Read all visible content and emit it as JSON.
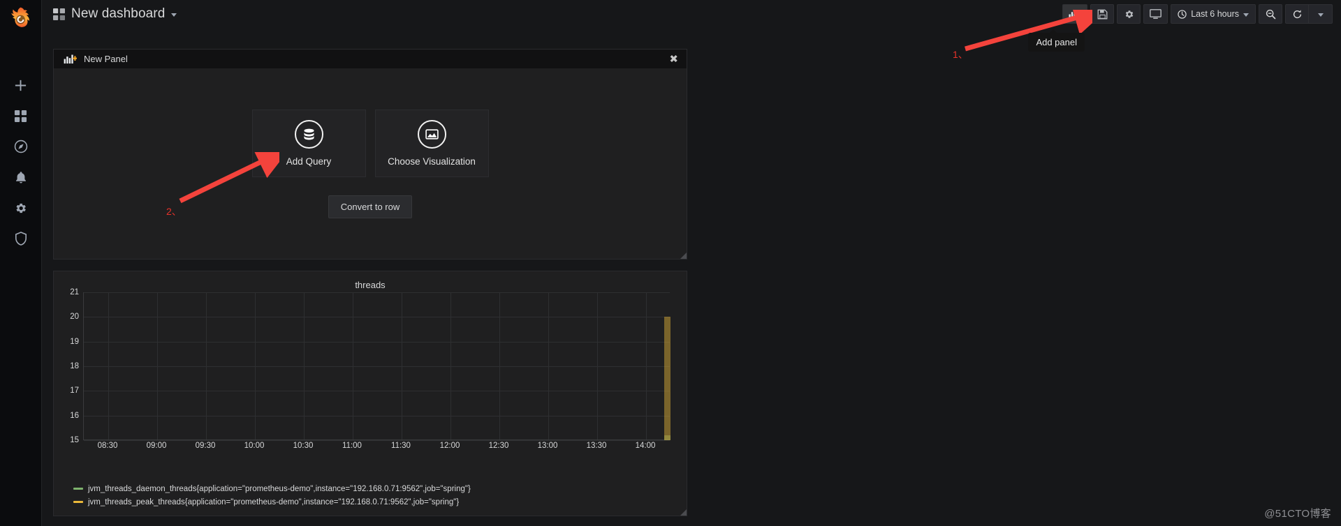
{
  "app": {
    "logo": "grafana-logo",
    "background": "#161719"
  },
  "sidebar": {
    "items": [
      {
        "name": "create-add",
        "icon": "plus-icon"
      },
      {
        "name": "dashboards",
        "icon": "dashboards-grid-icon"
      },
      {
        "name": "explore",
        "icon": "compass-icon"
      },
      {
        "name": "alerting",
        "icon": "bell-icon"
      },
      {
        "name": "configuration",
        "icon": "gear-icon"
      },
      {
        "name": "server-admin",
        "icon": "shield-icon"
      }
    ]
  },
  "topbar": {
    "dashboard_title": "New dashboard",
    "dashboard_icon": "grid-icon",
    "caret": "chevron-down-icon",
    "buttons": [
      {
        "name": "add-panel",
        "icon": "add-panel-icon",
        "tooltip": "Add panel",
        "active": true
      },
      {
        "name": "save-dashboard",
        "icon": "save-disk-icon"
      },
      {
        "name": "dashboard-settings",
        "icon": "gear-icon"
      },
      {
        "name": "cycle-view-mode",
        "icon": "monitor-icon"
      }
    ],
    "time_picker": {
      "icon": "clock-icon",
      "label": "Last 6 hours",
      "caret": "chevron-down-icon"
    },
    "zoom_out": {
      "name": "zoom-out",
      "icon": "search-minus-icon"
    },
    "refresh": {
      "name": "refresh",
      "icon": "refresh-icon"
    },
    "refresh_interval": {
      "name": "refresh-interval",
      "icon": "chevron-down-icon"
    }
  },
  "new_panel": {
    "icon": "add-panel-icon",
    "title": "New Panel",
    "close": "✖",
    "options": [
      {
        "name": "add-query",
        "icon": "database-icon",
        "label": "Add Query"
      },
      {
        "name": "choose-visualization",
        "icon": "graph-area-icon",
        "label": "Choose Visualization"
      }
    ],
    "convert_to_row": "Convert to row"
  },
  "annotations": [
    {
      "name": "annotation-1",
      "label": "1、",
      "color": "#e8322a"
    },
    {
      "name": "annotation-2",
      "label": "2、",
      "color": "#e8322a"
    }
  ],
  "watermark": "@51CTO博客",
  "chart_data": {
    "type": "line",
    "title": "threads",
    "xlabel": "",
    "ylabel": "",
    "ylim": [
      15,
      21
    ],
    "yticks": [
      15,
      16,
      17,
      18,
      19,
      20,
      21
    ],
    "x": [
      "08:30",
      "09:00",
      "09:30",
      "10:00",
      "10:30",
      "11:00",
      "11:30",
      "12:00",
      "12:30",
      "13:00",
      "13:30",
      "14:00"
    ],
    "grid": true,
    "legend_position": "bottom",
    "series": [
      {
        "name": "jvm_threads_daemon_threads{application=\"prometheus-demo\",instance=\"192.168.0.71:9562\",job=\"spring\"}",
        "color": "#7eb26d",
        "values": [
          null,
          null,
          null,
          null,
          null,
          null,
          null,
          null,
          null,
          null,
          null,
          15.2
        ]
      },
      {
        "name": "jvm_threads_peak_threads{application=\"prometheus-demo\",instance=\"192.168.0.71:9562\",job=\"spring\"}",
        "color": "#eab839",
        "values": [
          null,
          null,
          null,
          null,
          null,
          null,
          null,
          null,
          null,
          null,
          null,
          20.0
        ]
      }
    ]
  }
}
